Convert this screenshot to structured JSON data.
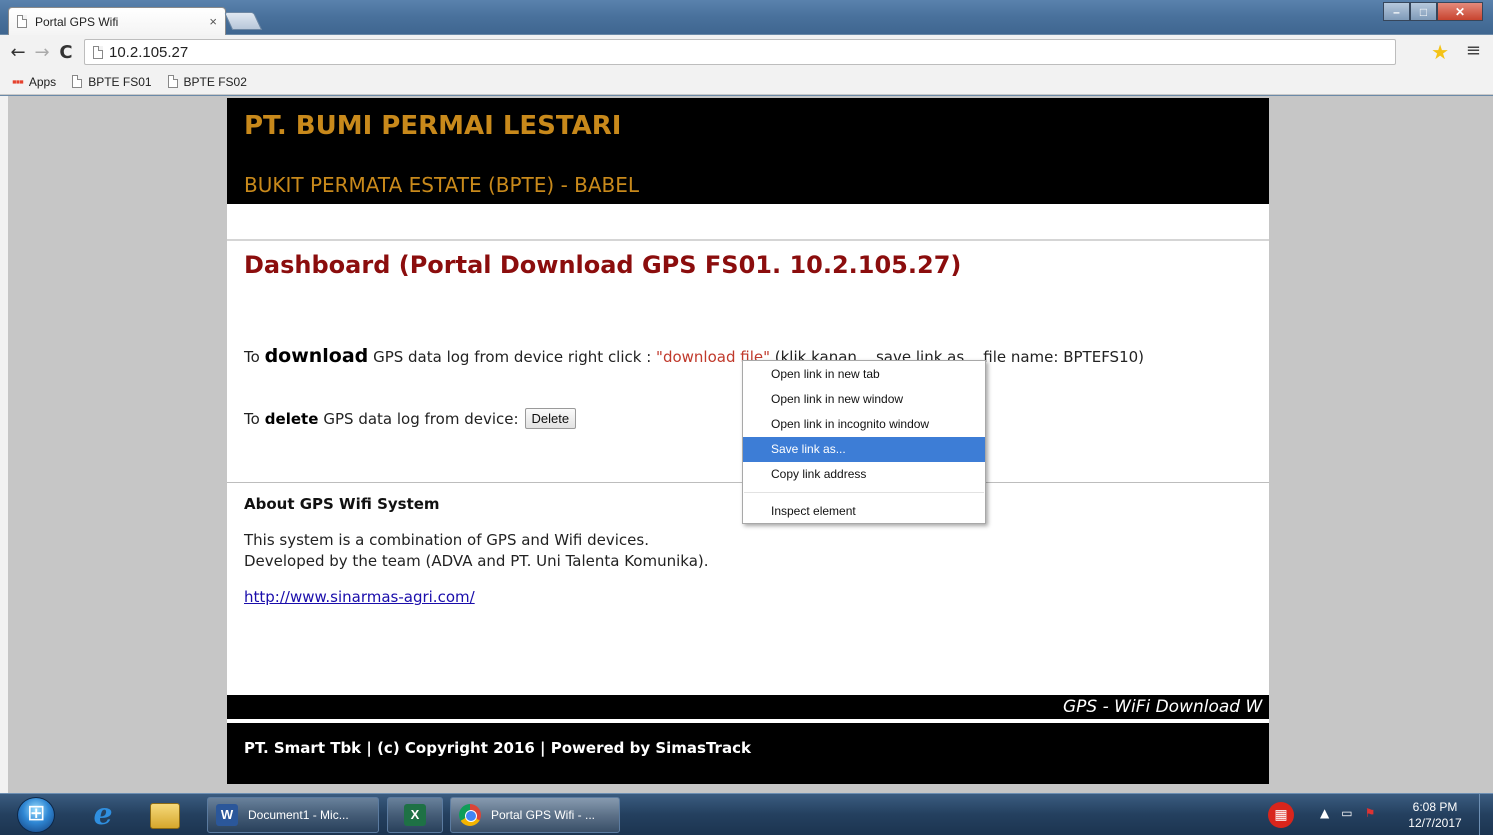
{
  "browser": {
    "tab_title": "Portal GPS Wifi",
    "tab_close": "×",
    "url": "10.2.105.27",
    "bookmarks": [
      {
        "label": "Apps"
      },
      {
        "label": "BPTE FS01"
      },
      {
        "label": "BPTE FS02"
      }
    ]
  },
  "page": {
    "site_title": "PT. BUMI PERMAI LESTARI",
    "site_subtitle": "BUKIT PERMATA ESTATE (BPTE) - BABEL",
    "dashboard_title": "Dashboard (Portal Download GPS FS01. 10.2.105.27)",
    "download_prefix": "To ",
    "download_keyword": "download",
    "download_middle": " GPS data log from device right click : ",
    "download_link": "\"download file\"",
    "download_suffix": " (klik kanan... save link as... file name: BPTEFS10)",
    "delete_prefix": "To",
    "delete_keyword": "delete",
    "delete_suffix": "GPS data log from device:",
    "delete_button": "Delete",
    "about_title": "About GPS Wifi System",
    "about_line1": "This system is a combination of GPS and Wifi devices.",
    "about_line2": "Developed by the team (ADVA and PT. Uni Talenta Komunika).",
    "site_link": "http://www.sinarmas-agri.com/",
    "marquee": "GPS - WiFi Download W",
    "footer": "PT. Smart Tbk | (c) Copyright 2016 | Powered by SimasTrack"
  },
  "context_menu": {
    "items": [
      "Open link in new tab",
      "Open link in new window",
      "Open link in incognito window",
      "Save link as...",
      "Copy link address",
      "Inspect element"
    ],
    "highlighted_index": 3
  },
  "taskbar": {
    "tasks": [
      {
        "label": "Document1 - Mic..."
      },
      {
        "label": "Portal GPS Wifi - ..."
      }
    ],
    "clock_time": "6:08 PM",
    "clock_date": "12/7/2017"
  },
  "colors": {
    "brand_gold": "#c8891b",
    "dashboard_red": "#8b0d0d",
    "menu_highlight": "#3d7dd6"
  }
}
